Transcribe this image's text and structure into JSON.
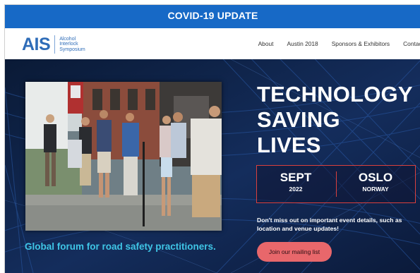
{
  "banner": {
    "text": "COVID-19 UPDATE"
  },
  "logo": {
    "mark": "AIS",
    "line1": "Alcohol",
    "line2": "Interlock",
    "line3": "Symposium"
  },
  "nav": {
    "items": [
      "About",
      "Austin 2018",
      "Sponsors & Exhibitors",
      "Contact"
    ]
  },
  "hero": {
    "headline": [
      "TECHNOLOGY",
      "SAVING",
      "LIVES"
    ],
    "date": {
      "month": "SEPT",
      "year": "2022"
    },
    "location": {
      "city": "OSLO",
      "country": "NORWAY"
    },
    "description": "Don't miss out on important event details, such as location and venue updates!",
    "cta_label": "Join our mailing list",
    "tagline": "Global forum for road safety practitioners."
  },
  "colors": {
    "banner_bg": "#1769c6",
    "logo_blue": "#2e6cb8",
    "hero_bg": "#0d1f3f",
    "accent_red": "#d9403e",
    "cta_bg": "#e8676b",
    "tagline": "#3fc5e6"
  }
}
